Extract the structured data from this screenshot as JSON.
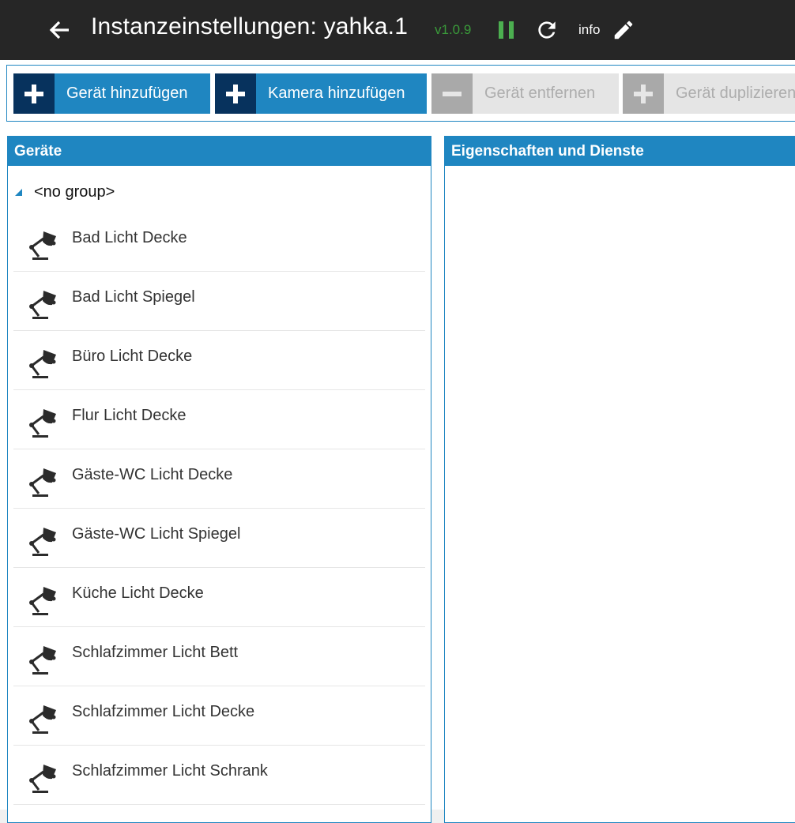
{
  "colors": {
    "titlebar_bg": "#262626",
    "accent_blue": "#1f86c1",
    "accent_dark": "#07325d",
    "version_green": "#3a9a3a",
    "pause_green": "#4caf50"
  },
  "titlebar": {
    "title": "Instanzeinstellungen: yahka.1",
    "version": "v1.0.9",
    "info_label": "info",
    "icons": [
      "back-arrow-icon",
      "pause-icon",
      "refresh-icon",
      "pencil-icon"
    ]
  },
  "toolbar": {
    "add_device": "Gerät hinzufügen",
    "add_camera": "Kamera hinzufügen",
    "remove_device": "Gerät entfernen",
    "duplicate_device": "Gerät duplizieren"
  },
  "devices_panel": {
    "title": "Geräte",
    "group": "<no group>",
    "device_icon": "desk-lamp-icon",
    "items": [
      {
        "label": "Bad Licht Decke"
      },
      {
        "label": "Bad Licht Spiegel"
      },
      {
        "label": "Büro Licht Decke"
      },
      {
        "label": "Flur Licht Decke"
      },
      {
        "label": "Gäste-WC Licht Decke"
      },
      {
        "label": "Gäste-WC Licht Spiegel"
      },
      {
        "label": "Küche Licht Decke"
      },
      {
        "label": "Schlafzimmer Licht Bett"
      },
      {
        "label": "Schlafzimmer Licht Decke"
      },
      {
        "label": "Schlafzimmer Licht Schrank"
      }
    ]
  },
  "properties_panel": {
    "title": "Eigenschaften und Dienste"
  }
}
